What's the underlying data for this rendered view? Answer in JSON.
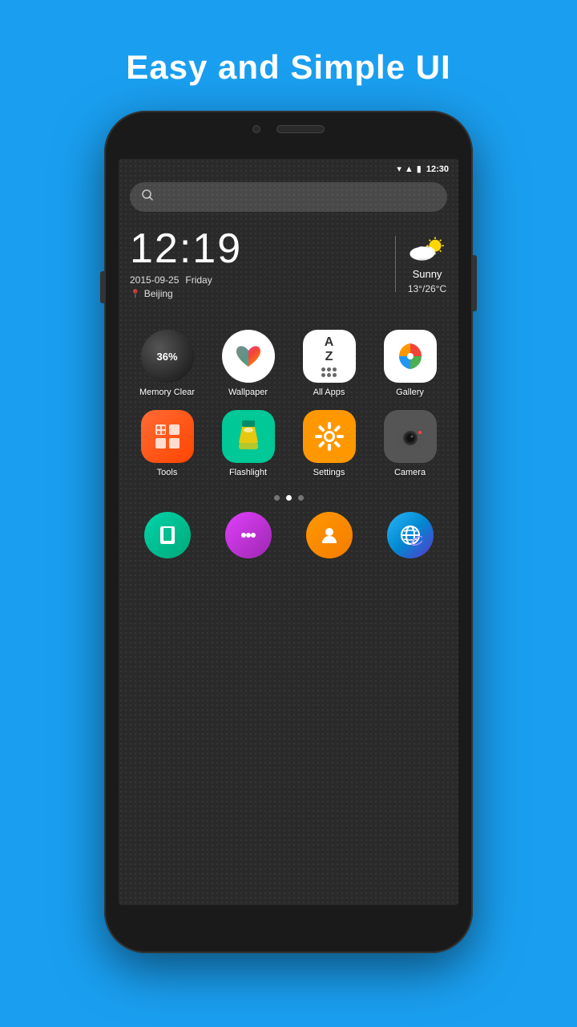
{
  "headline": "Easy and Simple UI",
  "status": {
    "time": "12:30"
  },
  "clock_widget": {
    "time": "12:19",
    "date": "2015-09-25",
    "day": "Friday",
    "location": "Beijing",
    "weather_desc": "Sunny",
    "weather_temp": "13°/26°C"
  },
  "apps_row1": [
    {
      "label": "Memory Clear",
      "percent": "36%"
    },
    {
      "label": "Wallpaper"
    },
    {
      "label": "All Apps"
    },
    {
      "label": "Gallery"
    }
  ],
  "apps_row2": [
    {
      "label": "Tools"
    },
    {
      "label": "Flashlight"
    },
    {
      "label": "Settings"
    },
    {
      "label": "Camera"
    }
  ],
  "dock": [
    {
      "label": "Phone"
    },
    {
      "label": "Message"
    },
    {
      "label": "Contacts"
    },
    {
      "label": "Browser"
    }
  ]
}
